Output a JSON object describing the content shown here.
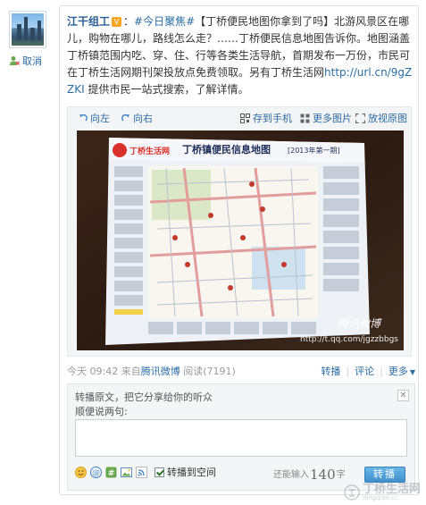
{
  "sidebar": {
    "unfollow_label": "取消"
  },
  "post": {
    "username": "江干组工",
    "topic": "#今日聚焦#",
    "body_1": "【丁桥便民地图你拿到了吗】北游风景区在哪儿，购物在哪儿，路线怎么走？……丁桥便民信息地图告诉你。地图涵盖丁桥镇范围内吃、穿、住、行等各类生活导航，首期发布一万份，市民可在丁桥生活网期刊架投放点免费领取。另有丁桥生活网",
    "url": "http://url.cn/9gZZKI",
    "body_2": " 提供市民一站式搜索，了解详情。"
  },
  "media_bar": {
    "rotate_left": "向左",
    "rotate_right": "向右",
    "save_phone": "存到手机",
    "more_images": "更多图片",
    "view_original": "放视原图"
  },
  "photo": {
    "logo_text": "丁桥生活网",
    "map_title": "丁桥镇便民信息地图",
    "issue": "[2013年第一期]",
    "watermark_brand": "腾讯微博",
    "watermark_url": "http://t.qq.com/jgzzbbgs"
  },
  "meta": {
    "time": "今天 09:42",
    "source_prefix": "来自",
    "source": "腾讯微博",
    "reads": "阅读(7191)",
    "repost": "转播",
    "comment": "评论",
    "more": "更多"
  },
  "composer": {
    "title": "转播原文，把它分享给你的听众",
    "subtitle": "顺便说两句:",
    "share_to_space": "转播到空间",
    "counter_prefix": "还能输入",
    "counter_value": "140",
    "counter_suffix": "字",
    "send": "转播"
  },
  "watermark": {
    "brand": "丁桥生活网",
    "url": "dingqiao.cc"
  },
  "colors": {
    "link": "#2b6ca3",
    "username": "#2b5f93",
    "button": "#3f8fcc"
  }
}
